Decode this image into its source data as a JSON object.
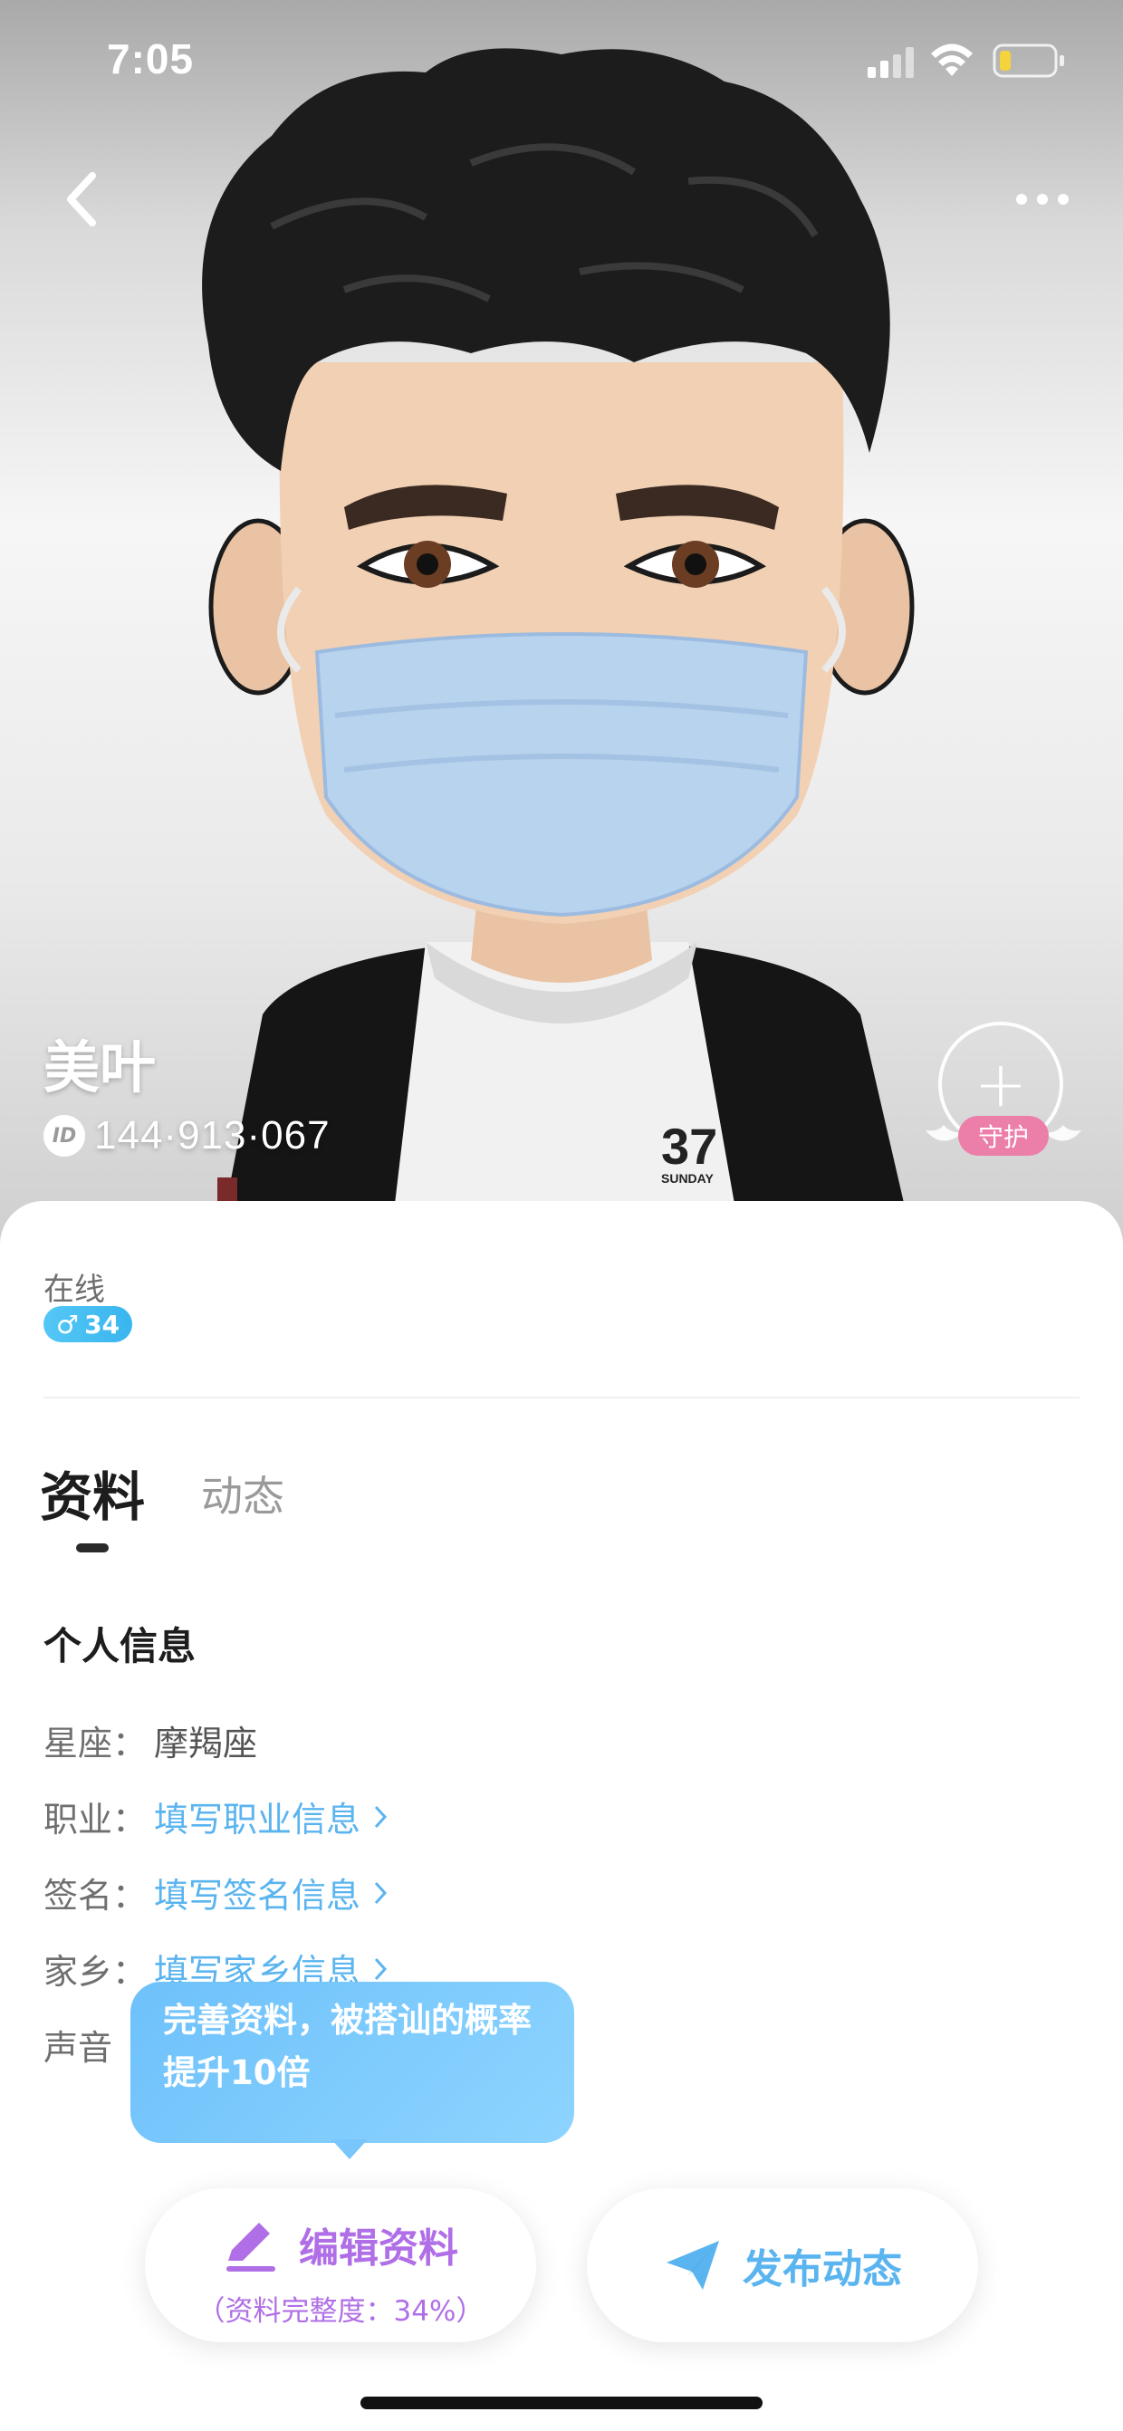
{
  "status_bar": {
    "time": "7:05"
  },
  "profile": {
    "name": "美叶",
    "id": "144·913·067",
    "guard_label": "守护",
    "status": "在线",
    "gender_symbol": "♂",
    "age": "34"
  },
  "tabs": [
    {
      "label": "资料",
      "active": true
    },
    {
      "label": "动态",
      "active": false
    }
  ],
  "section": {
    "title": "个人信息",
    "rows": [
      {
        "label": "星座：",
        "value": "摩羯座"
      },
      {
        "label": "职业：",
        "value": "填写职业信息"
      },
      {
        "label": "签名：",
        "value": "填写签名信息"
      },
      {
        "label": "家乡：",
        "value": "填写家乡信息"
      },
      {
        "label": "声音",
        "value": ""
      }
    ]
  },
  "tooltip": {
    "text": "完善资料，被搭讪的概率提升10倍"
  },
  "actions": {
    "edit_label": "编辑资料",
    "edit_sub": "（资料完整度：34%）",
    "post_label": "发布动态"
  },
  "colors": {
    "link": "#5ab4ef",
    "edit": "#b06fe6",
    "badge": "#39b5ee",
    "guard": "#ec7eaa"
  },
  "icons": [
    "back-arrow-icon",
    "more-dots-icon",
    "signal-icon",
    "wifi-icon",
    "battery-icon",
    "id-icon",
    "plus-icon",
    "pencil-icon",
    "paper-plane-icon",
    "chevron-right-icon"
  ]
}
